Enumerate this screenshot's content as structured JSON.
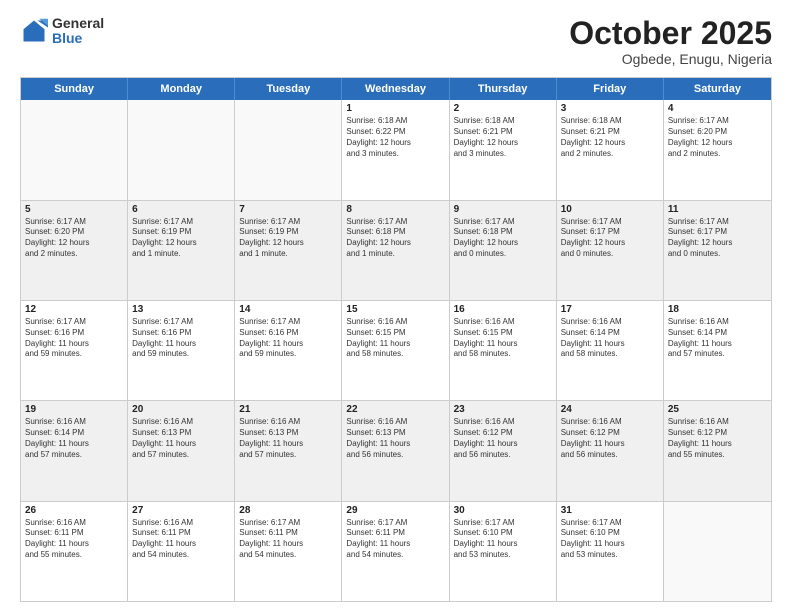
{
  "logo": {
    "general": "General",
    "blue": "Blue"
  },
  "header": {
    "title": "October 2025",
    "subtitle": "Ogbede, Enugu, Nigeria"
  },
  "days": [
    "Sunday",
    "Monday",
    "Tuesday",
    "Wednesday",
    "Thursday",
    "Friday",
    "Saturday"
  ],
  "weeks": [
    [
      {
        "day": "",
        "info": "",
        "empty": true
      },
      {
        "day": "",
        "info": "",
        "empty": true
      },
      {
        "day": "",
        "info": "",
        "empty": true
      },
      {
        "day": "1",
        "info": "Sunrise: 6:18 AM\nSunset: 6:22 PM\nDaylight: 12 hours\nand 3 minutes."
      },
      {
        "day": "2",
        "info": "Sunrise: 6:18 AM\nSunset: 6:21 PM\nDaylight: 12 hours\nand 3 minutes."
      },
      {
        "day": "3",
        "info": "Sunrise: 6:18 AM\nSunset: 6:21 PM\nDaylight: 12 hours\nand 2 minutes."
      },
      {
        "day": "4",
        "info": "Sunrise: 6:17 AM\nSunset: 6:20 PM\nDaylight: 12 hours\nand 2 minutes."
      }
    ],
    [
      {
        "day": "5",
        "info": "Sunrise: 6:17 AM\nSunset: 6:20 PM\nDaylight: 12 hours\nand 2 minutes."
      },
      {
        "day": "6",
        "info": "Sunrise: 6:17 AM\nSunset: 6:19 PM\nDaylight: 12 hours\nand 1 minute."
      },
      {
        "day": "7",
        "info": "Sunrise: 6:17 AM\nSunset: 6:19 PM\nDaylight: 12 hours\nand 1 minute."
      },
      {
        "day": "8",
        "info": "Sunrise: 6:17 AM\nSunset: 6:18 PM\nDaylight: 12 hours\nand 1 minute."
      },
      {
        "day": "9",
        "info": "Sunrise: 6:17 AM\nSunset: 6:18 PM\nDaylight: 12 hours\nand 0 minutes."
      },
      {
        "day": "10",
        "info": "Sunrise: 6:17 AM\nSunset: 6:17 PM\nDaylight: 12 hours\nand 0 minutes."
      },
      {
        "day": "11",
        "info": "Sunrise: 6:17 AM\nSunset: 6:17 PM\nDaylight: 12 hours\nand 0 minutes."
      }
    ],
    [
      {
        "day": "12",
        "info": "Sunrise: 6:17 AM\nSunset: 6:16 PM\nDaylight: 11 hours\nand 59 minutes."
      },
      {
        "day": "13",
        "info": "Sunrise: 6:17 AM\nSunset: 6:16 PM\nDaylight: 11 hours\nand 59 minutes."
      },
      {
        "day": "14",
        "info": "Sunrise: 6:17 AM\nSunset: 6:16 PM\nDaylight: 11 hours\nand 59 minutes."
      },
      {
        "day": "15",
        "info": "Sunrise: 6:16 AM\nSunset: 6:15 PM\nDaylight: 11 hours\nand 58 minutes."
      },
      {
        "day": "16",
        "info": "Sunrise: 6:16 AM\nSunset: 6:15 PM\nDaylight: 11 hours\nand 58 minutes."
      },
      {
        "day": "17",
        "info": "Sunrise: 6:16 AM\nSunset: 6:14 PM\nDaylight: 11 hours\nand 58 minutes."
      },
      {
        "day": "18",
        "info": "Sunrise: 6:16 AM\nSunset: 6:14 PM\nDaylight: 11 hours\nand 57 minutes."
      }
    ],
    [
      {
        "day": "19",
        "info": "Sunrise: 6:16 AM\nSunset: 6:14 PM\nDaylight: 11 hours\nand 57 minutes."
      },
      {
        "day": "20",
        "info": "Sunrise: 6:16 AM\nSunset: 6:13 PM\nDaylight: 11 hours\nand 57 minutes."
      },
      {
        "day": "21",
        "info": "Sunrise: 6:16 AM\nSunset: 6:13 PM\nDaylight: 11 hours\nand 57 minutes."
      },
      {
        "day": "22",
        "info": "Sunrise: 6:16 AM\nSunset: 6:13 PM\nDaylight: 11 hours\nand 56 minutes."
      },
      {
        "day": "23",
        "info": "Sunrise: 6:16 AM\nSunset: 6:12 PM\nDaylight: 11 hours\nand 56 minutes."
      },
      {
        "day": "24",
        "info": "Sunrise: 6:16 AM\nSunset: 6:12 PM\nDaylight: 11 hours\nand 56 minutes."
      },
      {
        "day": "25",
        "info": "Sunrise: 6:16 AM\nSunset: 6:12 PM\nDaylight: 11 hours\nand 55 minutes."
      }
    ],
    [
      {
        "day": "26",
        "info": "Sunrise: 6:16 AM\nSunset: 6:11 PM\nDaylight: 11 hours\nand 55 minutes."
      },
      {
        "day": "27",
        "info": "Sunrise: 6:16 AM\nSunset: 6:11 PM\nDaylight: 11 hours\nand 54 minutes."
      },
      {
        "day": "28",
        "info": "Sunrise: 6:17 AM\nSunset: 6:11 PM\nDaylight: 11 hours\nand 54 minutes."
      },
      {
        "day": "29",
        "info": "Sunrise: 6:17 AM\nSunset: 6:11 PM\nDaylight: 11 hours\nand 54 minutes."
      },
      {
        "day": "30",
        "info": "Sunrise: 6:17 AM\nSunset: 6:10 PM\nDaylight: 11 hours\nand 53 minutes."
      },
      {
        "day": "31",
        "info": "Sunrise: 6:17 AM\nSunset: 6:10 PM\nDaylight: 11 hours\nand 53 minutes."
      },
      {
        "day": "",
        "info": "",
        "empty": true
      }
    ]
  ]
}
